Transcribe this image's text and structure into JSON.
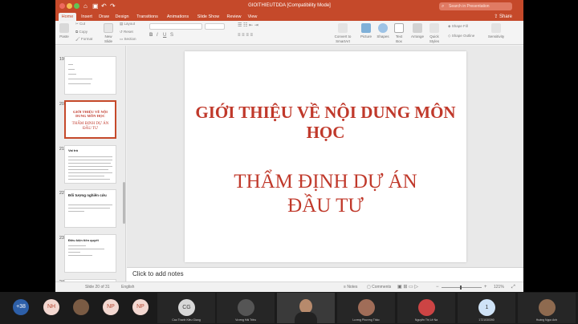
{
  "window": {
    "title": "GIOITHIEUTDDA [Compatibility Mode]",
    "search_placeholder": "Search in Presentation",
    "share_label": "Share"
  },
  "traffic_lights": [
    {
      "name": "close",
      "color": "#ee6a5e"
    },
    {
      "name": "minimize",
      "color": "#f5bd4f"
    },
    {
      "name": "maximize",
      "color": "#61c454"
    }
  ],
  "tabs": [
    "Home",
    "Insert",
    "Draw",
    "Design",
    "Transitions",
    "Animations",
    "Slide Show",
    "Review",
    "View"
  ],
  "active_tab": "Home",
  "ribbon": {
    "paste": "Paste",
    "cut": "Cut",
    "copy": "Copy",
    "format": "Format",
    "new_slide": "New Slide",
    "layout": "Layout",
    "reset": "Reset",
    "section": "Section",
    "convert_to_smartart": "Convert to SmartArt",
    "picture": "Picture",
    "shapes": "Shapes",
    "text_box": "Text Box",
    "arrange": "Arrange",
    "quick_styles": "Quick Styles",
    "shape_fill": "Shape Fill",
    "shape_outline": "Shape Outline",
    "sensitivity": "Sensitivity"
  },
  "slides": [
    {
      "number": "19",
      "title": ""
    },
    {
      "number": "20",
      "title": "GIỚI THIỆU VỀ NỘI DUNG MÔN HỌC",
      "subtitle": "THẨM ĐỊNH DỰ ÁN ĐẦU TƯ"
    },
    {
      "number": "21",
      "title": "Vai trò"
    },
    {
      "number": "22",
      "title": "Đối tượng nghiên cứu"
    },
    {
      "number": "23",
      "title": "Điều kiện tiên quyết"
    },
    {
      "number": "24",
      "title": ""
    }
  ],
  "current_slide": {
    "title": "GIỚI THIỆU VỀ NỘI DUNG MÔN HỌC",
    "subtitle": "THẨM ĐỊNH DỰ ÁN ĐẦU TƯ",
    "text_color": "#c0392b"
  },
  "notes_placeholder": "Click to add notes",
  "status": {
    "slide_counter": "Slide 20 of 31",
    "language": "English",
    "notes": "Notes",
    "comments": "Comments",
    "zoom": "121%"
  },
  "meeting": {
    "overflow_count": "+38",
    "participants": [
      {
        "initials": "NH",
        "name": "",
        "color": "#f3d8d1",
        "text": "#b64a34"
      },
      {
        "initials": "",
        "name": "",
        "color": "#7a5b44",
        "text": "#fff"
      },
      {
        "initials": "NP",
        "name": "",
        "color": "#f3d8d1",
        "text": "#b64a34"
      },
      {
        "initials": "NP",
        "name": "",
        "color": "#f3d8d1",
        "text": "#b64a34"
      },
      {
        "initials": "CG",
        "name": "Cao Thanh Kiều Giang",
        "color": "#d8d8d8",
        "text": "#444"
      },
      {
        "initials": "",
        "name": "Vương Hải Triều",
        "color": "#555",
        "text": "#fff"
      },
      {
        "initials": "",
        "name": "",
        "color": "#3a3a3a",
        "text": "#fff"
      },
      {
        "initials": "",
        "name": "Lương Phương Thảo",
        "color": "#a06d58",
        "text": "#fff"
      },
      {
        "initials": "",
        "name": "Nguyễn Thị Lê Na",
        "color": "#c44",
        "text": "#fff"
      },
      {
        "initials": "1",
        "name": "1721030390",
        "color": "#cfe3f7",
        "text": "#333"
      },
      {
        "initials": "",
        "name": "Hoàng Ngọc Anh",
        "color": "#8e6a4f",
        "text": "#fff"
      }
    ]
  }
}
